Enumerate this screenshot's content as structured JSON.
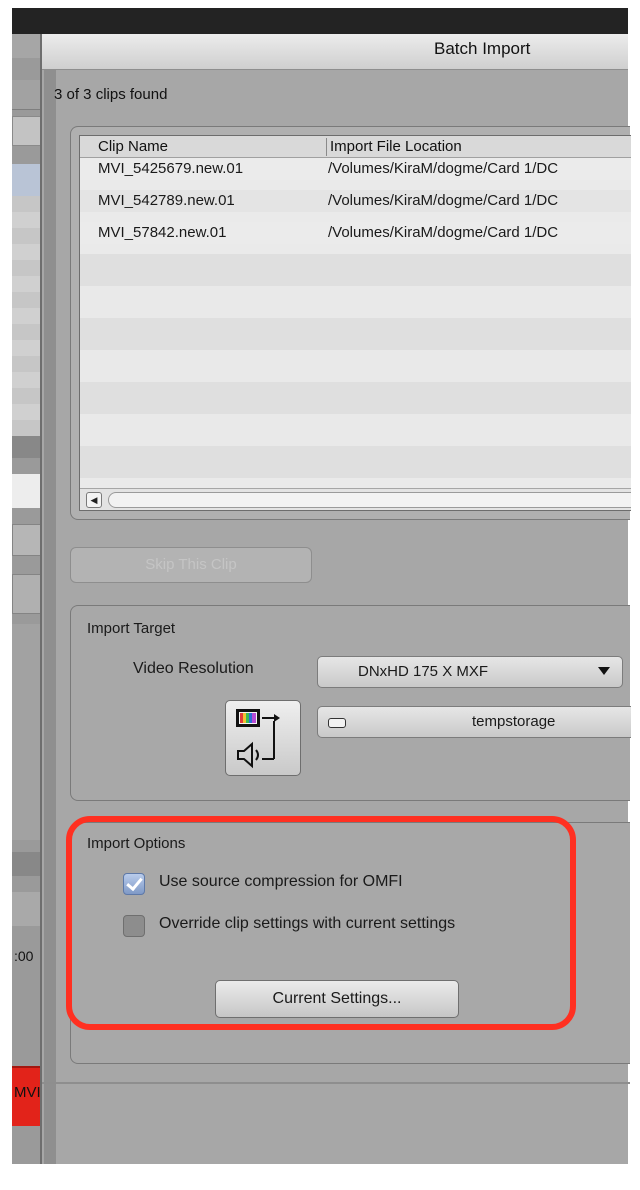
{
  "dialog": {
    "title": "Batch Import",
    "clips_found": "3 of 3 clips found"
  },
  "table": {
    "columns": [
      "Clip Name",
      "Import File Location"
    ],
    "rows": [
      {
        "clip_name": "MVI_5425679.new.01",
        "location": "/Volumes/KiraM/dogme/Card 1/DC"
      },
      {
        "clip_name": "MVI_542789.new.01",
        "location": "/Volumes/KiraM/dogme/Card 1/DC"
      },
      {
        "clip_name": "MVI_57842.new.01",
        "location": "/Volumes/KiraM/dogme/Card 1/DC"
      }
    ]
  },
  "skip_button": "Skip This Clip",
  "import_target": {
    "label": "Import Target",
    "video_resolution_label": "Video Resolution",
    "video_resolution_value": "DNxHD 175 X  MXF",
    "storage_value": "tempstorage"
  },
  "import_options": {
    "label": "Import Options",
    "use_source_compression": {
      "label": "Use source compression for OMFI",
      "checked": true
    },
    "override_clip_settings": {
      "label": "Override clip settings with current settings",
      "checked": false
    },
    "current_settings_button": "Current Settings..."
  },
  "background_app": {
    "timecode_fragment": ":00",
    "red_label_fragment": "MVI"
  },
  "colors": {
    "highlight": "#ff3021",
    "dialog_bg": "#a7a7a7",
    "checkbox_checked": "#7f99c6",
    "red_tab": "#e2231a"
  }
}
